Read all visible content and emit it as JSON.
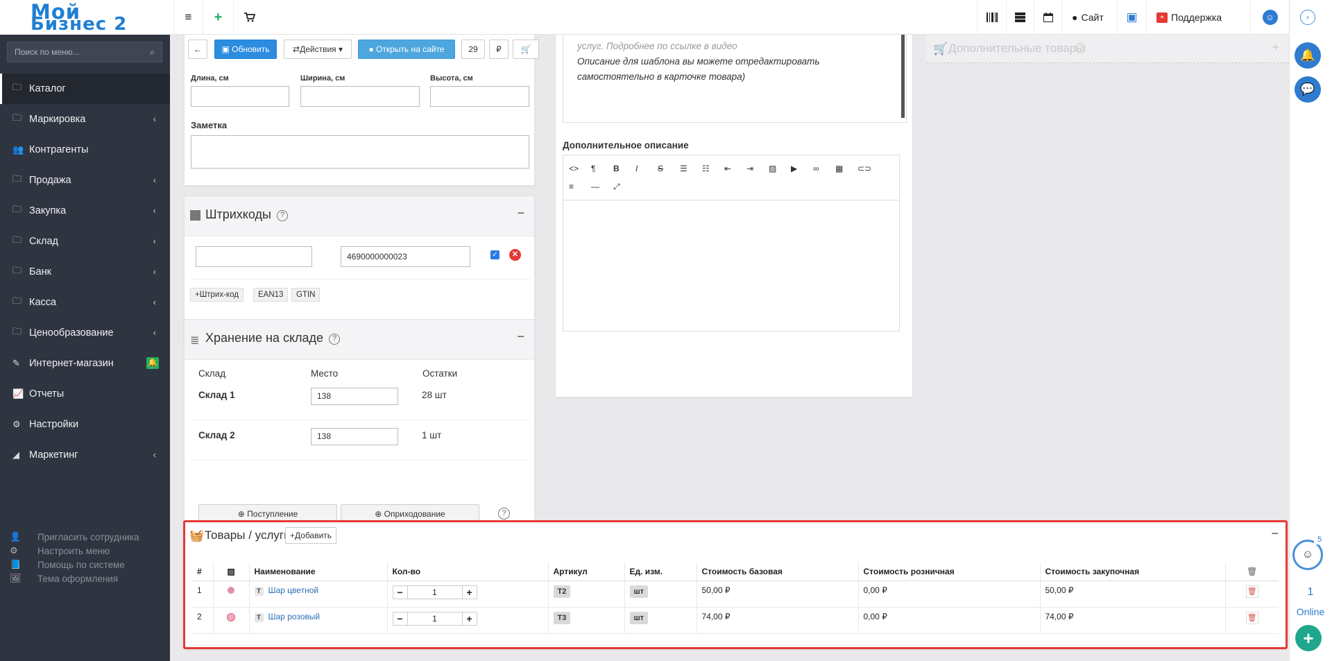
{
  "logo": {
    "line1": "Мой",
    "line2": "Бизнес 2"
  },
  "topbar": {
    "menu_icon": "≡",
    "add_icon": "+",
    "cart_icon": "cart",
    "site_label": "Сайт",
    "support_label": "Поддержка"
  },
  "sidebar": {
    "search_placeholder": "Поиск по меню...",
    "items": [
      {
        "label": "Каталог",
        "icon": "folder-icon",
        "chevron": false
      },
      {
        "label": "Маркировка",
        "icon": "folder-icon",
        "chevron": true
      },
      {
        "label": "Контрагенты",
        "icon": "users-icon",
        "chevron": false
      },
      {
        "label": "Продажа",
        "icon": "folder-icon",
        "chevron": true
      },
      {
        "label": "Закупка",
        "icon": "folder-icon",
        "chevron": true
      },
      {
        "label": "Склад",
        "icon": "folder-icon",
        "chevron": true
      },
      {
        "label": "Банк",
        "icon": "folder-icon",
        "chevron": true
      },
      {
        "label": "Касса",
        "icon": "folder-icon",
        "chevron": true
      },
      {
        "label": "Ценообразование",
        "icon": "folder-icon",
        "chevron": true
      },
      {
        "label": "Интернет-магазин",
        "icon": "wand-icon",
        "chevron": false
      },
      {
        "label": "Отчеты",
        "icon": "chart-icon",
        "chevron": false
      },
      {
        "label": "Настройки",
        "icon": "gear-icon",
        "chevron": false
      },
      {
        "label": "Маркетинг",
        "icon": "area-chart-icon",
        "chevron": true
      }
    ],
    "sub_items": [
      "Пригласить сотрудника",
      "Настроить меню",
      "Помощь по системе",
      "Тема оформления"
    ]
  },
  "toolbar": {
    "refresh_label": "Обновить",
    "actions_label": "Действия",
    "open_site_label": "Открыть на сайте",
    "count": "29",
    "currency": "₽"
  },
  "dimensions": {
    "length_label": "Длина, см",
    "width_label": "Ширина, см",
    "height_label": "Высота, см"
  },
  "note": {
    "label": "Заметка"
  },
  "description": {
    "line0": "услуг. Подробнее по ссылке в видео",
    "line1": "Описание для шаблона вы можете отредактировать",
    "line2": "самостоятельно в карточке товара)"
  },
  "additional_description": {
    "label": "Дополнительное описание"
  },
  "additional_goods": {
    "title": "Дополнительные товары"
  },
  "barcodes": {
    "title": "Штрихкоды",
    "code_value": "4690000000023",
    "add_label": "Штрих-код",
    "ean_label": "EAN13",
    "gtin_label": "GTIN"
  },
  "storage": {
    "title": "Хранение на складе",
    "col_warehouse": "Склад",
    "col_place": "Место",
    "col_stock": "Остатки",
    "rows": [
      {
        "name": "Склад 1",
        "place": "138",
        "stock": "28 шт"
      },
      {
        "name": "Склад 2",
        "place": "138",
        "stock": "1 шт"
      }
    ],
    "receipt_label": "Поступление",
    "capitalize_label": "Оприходование"
  },
  "goods": {
    "title": "Товары / услуги",
    "add_label": "Добавить",
    "headers": {
      "num": "#",
      "name": "Наименование",
      "qty": "Кол-во",
      "article": "Артикул",
      "unit": "Ед. изм.",
      "base": "Стоимость базовая",
      "retail": "Стоимость розничная",
      "purchase": "Стоимость закупочная"
    },
    "rows": [
      {
        "num": "1",
        "type": "Т",
        "name": "Шар цветной",
        "qty": "1",
        "article": "Т2",
        "unit": "шт",
        "base": "50,00 ₽",
        "retail": "0,00 ₽",
        "purchase": "50,00 ₽"
      },
      {
        "num": "2",
        "type": "Т",
        "name": "Шар розовый",
        "qty": "1",
        "article": "Т3",
        "unit": "шт",
        "base": "74,00 ₽",
        "retail": "0,00 ₽",
        "purchase": "74,00 ₽"
      }
    ]
  },
  "right": {
    "badge": "5",
    "online_count": "1",
    "online_label": "Online"
  },
  "colors": {
    "accent": "#2c8ce0",
    "sidebar": "#2f3441",
    "highlight": "#e53935"
  }
}
